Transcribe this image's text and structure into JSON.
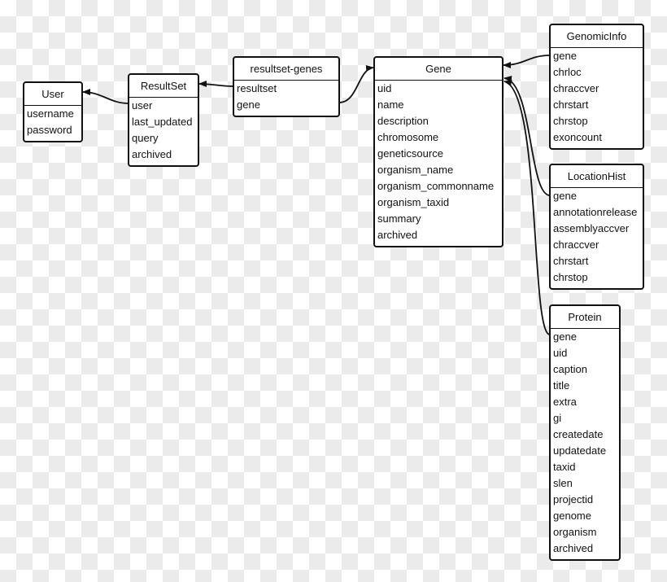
{
  "entities": {
    "user": {
      "title": "User",
      "fields": [
        "username",
        "password"
      ]
    },
    "resultset": {
      "title": "ResultSet",
      "fields": [
        "user",
        "last_updated",
        "query",
        "archived"
      ]
    },
    "resultset_genes": {
      "title": "resultset-genes",
      "fields": [
        "resultset",
        "gene"
      ]
    },
    "gene": {
      "title": "Gene",
      "fields": [
        "uid",
        "name",
        "description",
        "chromosome",
        "geneticsource",
        "organism_name",
        "organism_commonname",
        "organism_taxid",
        "summary",
        "archived"
      ]
    },
    "genomicinfo": {
      "title": "GenomicInfo",
      "fields": [
        "gene",
        "chrloc",
        "chraccver",
        "chrstart",
        "chrstop",
        "exoncount"
      ]
    },
    "locationhist": {
      "title": "LocationHist",
      "fields": [
        "gene",
        "annotationrelease",
        "assemblyaccver",
        "chraccver",
        "chrstart",
        "chrstop"
      ]
    },
    "protein": {
      "title": "Protein",
      "fields": [
        "gene",
        "uid",
        "caption",
        "title",
        "extra",
        "gi",
        "createdate",
        "updatedate",
        "taxid",
        "slen",
        "projectid",
        "genome",
        "organism",
        "archived"
      ]
    }
  },
  "relations": [
    {
      "from": "resultset.user",
      "to": "user"
    },
    {
      "from": "resultset_genes.resultset",
      "to": "resultset"
    },
    {
      "from": "resultset_genes.gene",
      "to": "gene"
    },
    {
      "from": "genomicinfo.gene",
      "to": "gene"
    },
    {
      "from": "locationhist.gene",
      "to": "gene"
    },
    {
      "from": "protein.gene",
      "to": "gene"
    }
  ]
}
